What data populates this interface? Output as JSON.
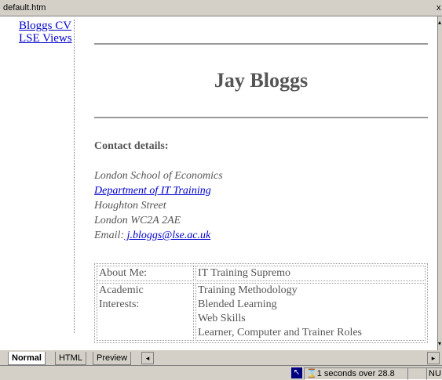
{
  "window": {
    "title": "default.htm",
    "close_glyph": "x"
  },
  "nav": {
    "items": [
      {
        "label": "Bloggs CV"
      },
      {
        "label": "LSE Views"
      }
    ]
  },
  "page": {
    "name": "Jay Bloggs",
    "contact_heading": "Contact details:",
    "address": {
      "line1": "London School of Economics",
      "dept_link": "Department of IT Training",
      "line3": "Houghton Street",
      "line4": "London WC2A 2AE",
      "email_label": "Email:",
      "email_link": " j.bloggs@lse.ac.uk"
    },
    "table": {
      "about_label": "About Me:",
      "about_value": "IT Training Supremo",
      "interests_label_1": "Academic",
      "interests_label_2": "Interests:",
      "interests": [
        "Training Methodology",
        "Blended Learning",
        "Web Skills",
        "Learner, Computer and Trainer Roles"
      ]
    }
  },
  "tabs": {
    "normal": "Normal",
    "html": "HTML",
    "preview": "Preview"
  },
  "status": {
    "download_time": "1 seconds over 28.8",
    "panel_mode": "NU",
    "icons": [
      "pointer-icon",
      "hourglass-icon"
    ]
  }
}
